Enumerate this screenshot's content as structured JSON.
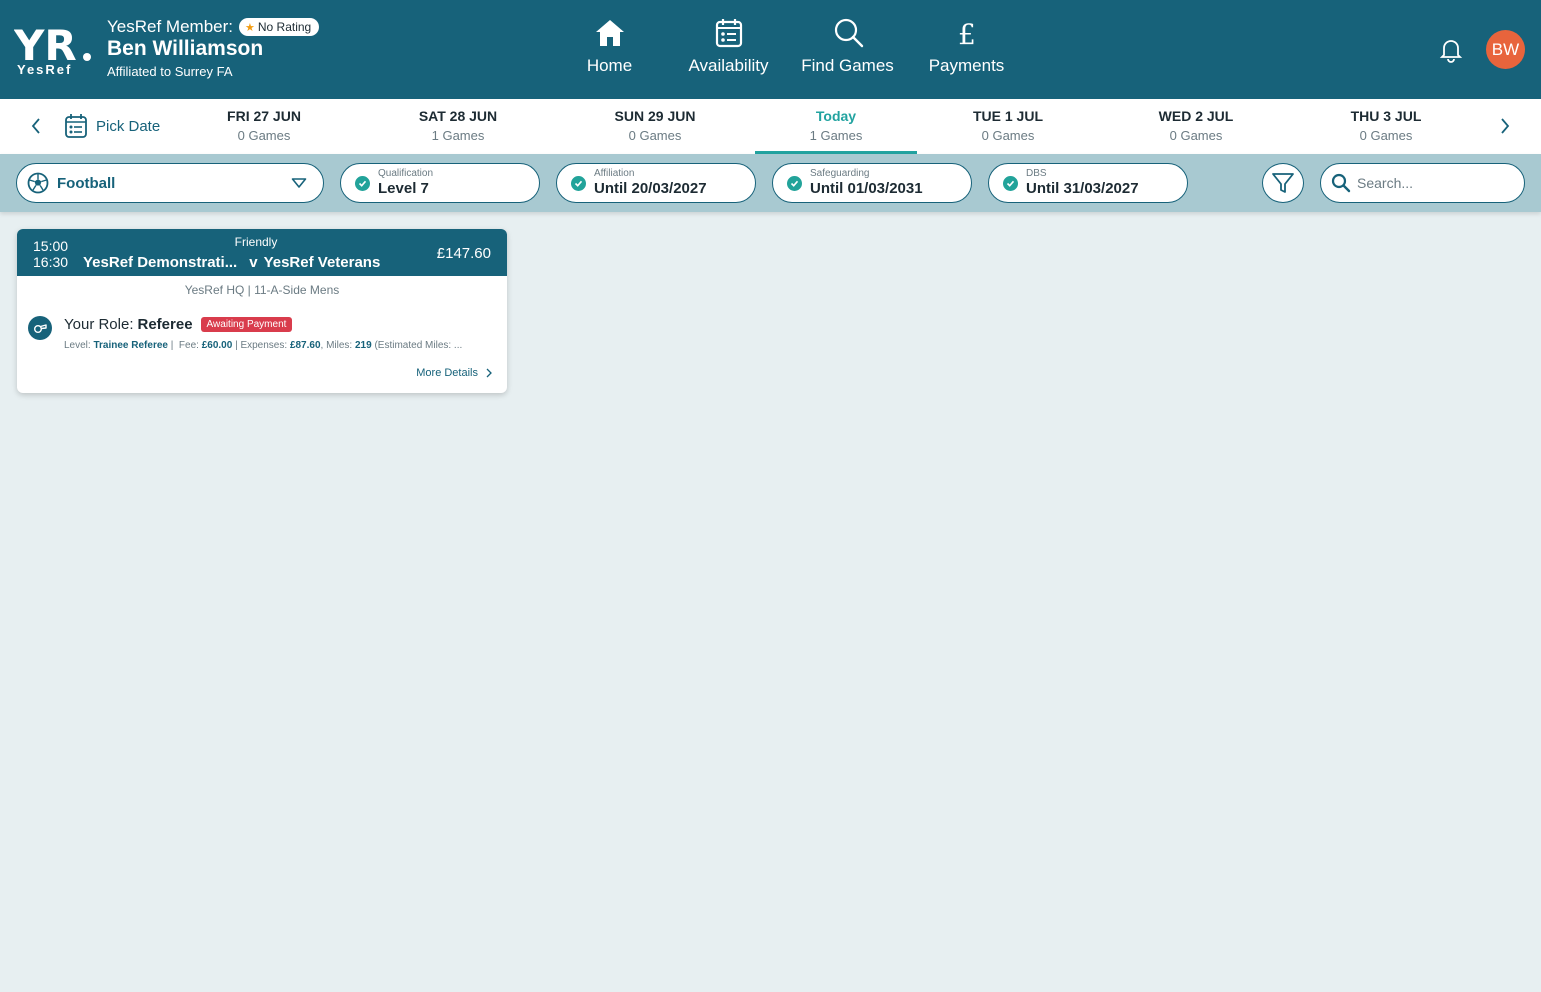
{
  "brand": {
    "logo_text": "YesRef",
    "primary": "#17627a",
    "accent": "#22a3a0",
    "avatar_bg": "#e8643c",
    "badge_red": "#d93c4c"
  },
  "member": {
    "label": "YesRef Member:",
    "rating": "No Rating",
    "name": "Ben Williamson",
    "affiliation": "Affiliated to Surrey FA",
    "initials": "BW"
  },
  "nav": [
    {
      "label": "Home",
      "icon": "home-icon"
    },
    {
      "label": "Availability",
      "icon": "calendar-icon"
    },
    {
      "label": "Find Games",
      "icon": "search-icon"
    },
    {
      "label": "Payments",
      "icon": "pound-icon"
    }
  ],
  "date_strip": {
    "pick_date": "Pick Date",
    "days": [
      {
        "label": "FRI 27 JUN",
        "count": "0 Games",
        "active": false
      },
      {
        "label": "SAT 28 JUN",
        "count": "1 Games",
        "active": false
      },
      {
        "label": "SUN 29 JUN",
        "count": "0 Games",
        "active": false
      },
      {
        "label": "Today",
        "count": "1 Games",
        "active": true
      },
      {
        "label": "TUE 1 JUL",
        "count": "0 Games",
        "active": false
      },
      {
        "label": "WED 2 JUL",
        "count": "0 Games",
        "active": false
      },
      {
        "label": "THU 3 JUL",
        "count": "0 Games",
        "active": false
      }
    ]
  },
  "filters": {
    "sport": "Football",
    "statuses": [
      {
        "caption": "Qualification",
        "value": "Level 7"
      },
      {
        "caption": "Affiliation",
        "value": "Until 20/03/2027"
      },
      {
        "caption": "Safeguarding",
        "value": "Until 01/03/2031"
      },
      {
        "caption": "DBS",
        "value": "Until 31/03/2027"
      }
    ],
    "search_placeholder": "Search..."
  },
  "game": {
    "start": "15:00",
    "end": "16:30",
    "type": "Friendly",
    "home": "YesRef Demonstrati...",
    "vs": "v",
    "away": "YesRef Veterans",
    "total": "£147.60",
    "venue": "YesRef HQ | 11-A-Side Mens",
    "role_label": "Your Role:",
    "role": "Referee",
    "status_badge": "Awaiting Payment",
    "level_label": "Level:",
    "level": "Trainee Referee",
    "fee_label": "Fee:",
    "fee": "£60.00",
    "expenses_label": "Expenses:",
    "expenses": "£87.60",
    "miles_label": "Miles:",
    "miles": "219",
    "estimated": "(Estimated Miles: ...",
    "more_details": "More Details"
  }
}
